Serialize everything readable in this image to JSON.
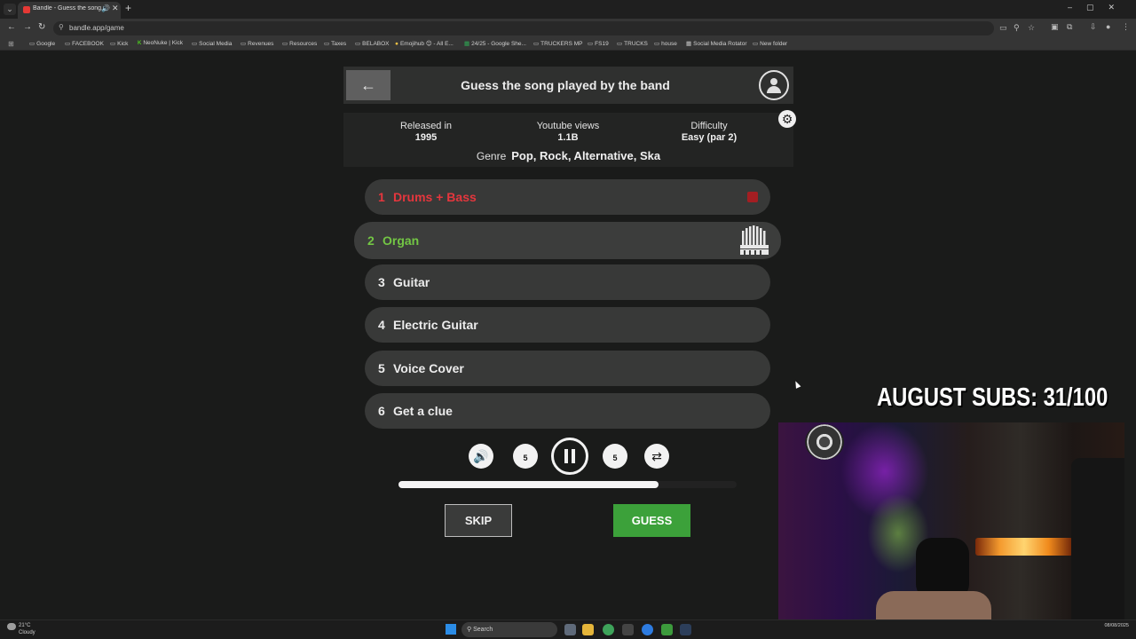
{
  "browser": {
    "tab_title": "Bandle - Guess the song, o",
    "url": "bandle.app/game",
    "bookmarks": [
      "Google",
      "FACEBOOK",
      "Kick",
      "NeoNuke | Kick",
      "Social Media",
      "Revenues",
      "Resources",
      "Taxes",
      "BELABOX",
      "Emojihub 😊 - All E...",
      "24/25 - Google She...",
      "TRUCKERS MP",
      "FS19",
      "TRUCKS",
      "house",
      "Social Media Rotator",
      "New folder"
    ]
  },
  "game": {
    "title": "Guess the song played by the band",
    "info": {
      "released_label": "Released in",
      "released_value": "1995",
      "views_label": "Youtube views",
      "views_value": "1.1B",
      "difficulty_label": "Difficulty",
      "difficulty_value": "Easy (par 2)",
      "genre_label": "Genre",
      "genre_value": "Pop, Rock, Alternative, Ska"
    },
    "steps": [
      {
        "num": "1",
        "label": "Drums + Bass",
        "state": "failed"
      },
      {
        "num": "2",
        "label": "Organ",
        "state": "active"
      },
      {
        "num": "3",
        "label": "Guitar",
        "state": "locked"
      },
      {
        "num": "4",
        "label": "Electric Guitar",
        "state": "locked"
      },
      {
        "num": "5",
        "label": "Voice Cover",
        "state": "locked"
      },
      {
        "num": "6",
        "label": "Get a clue",
        "state": "locked"
      }
    ],
    "rewind_seconds": "5",
    "forward_seconds": "5",
    "progress": 0.77,
    "skip_label": "SKIP",
    "guess_label": "GUESS"
  },
  "overlay": {
    "subs_text": "AUGUST SUBS: 31/100"
  },
  "taskbar": {
    "temperature": "21°C",
    "weather": "Cloudy",
    "search_placeholder": "Search",
    "date": "08/08/2025"
  },
  "colors": {
    "failed": "#e5363d",
    "active": "#73c644",
    "guess_button": "#3ca13a"
  }
}
